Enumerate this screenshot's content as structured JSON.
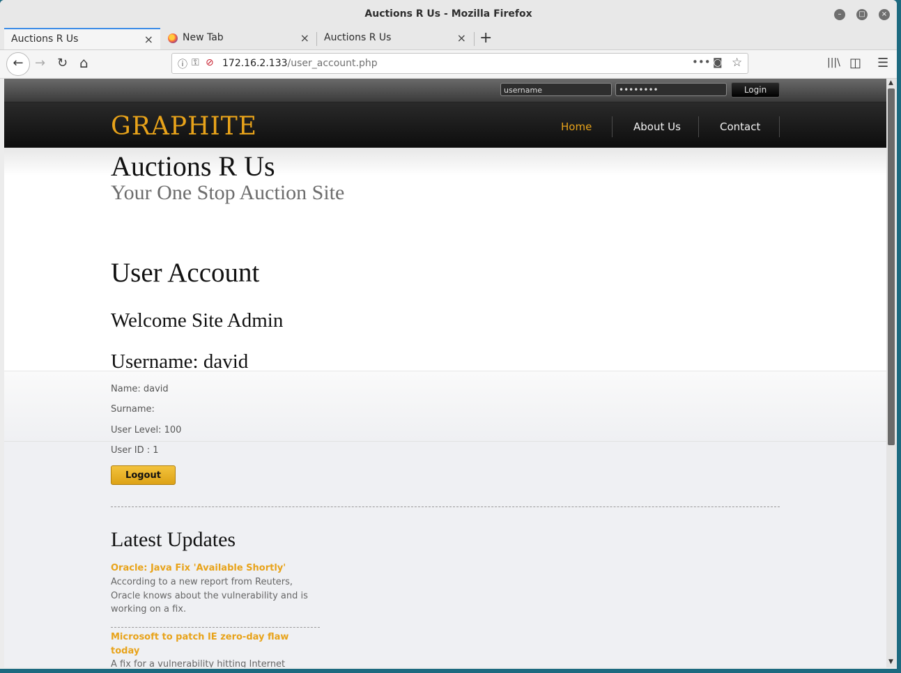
{
  "window": {
    "title": "Auctions R Us - Mozilla Firefox"
  },
  "tabs": [
    {
      "label": "Auctions R Us",
      "close": "×"
    },
    {
      "label": "New Tab",
      "close": "×"
    },
    {
      "label": "Auctions R Us",
      "close": "×"
    }
  ],
  "newtab": "+",
  "nav": {
    "url_host": "172.16.2.133",
    "url_path": "/user_account.php",
    "back": "←",
    "forward": "→",
    "reload": "↻",
    "home": "⌂",
    "more": "•••",
    "pocket": "◙",
    "bookmark": "☆",
    "library": "|||\\",
    "sidebar": "◫",
    "menu": "☰"
  },
  "login": {
    "username_placeholder": "username",
    "password_value": "••••••••",
    "button": "Login"
  },
  "site": {
    "logo": "GRAPHITE",
    "menu": [
      "Home",
      "About Us",
      "Contact"
    ],
    "title": "Auctions R Us",
    "subtitle": "Your One Stop Auction Site"
  },
  "account": {
    "heading": "User Account",
    "welcome": "Welcome Site Admin",
    "username": "Username: david",
    "name": "Name: david",
    "surname": "Surname:",
    "level": "User Level: 100",
    "userid": "User ID : 1",
    "logout": "Logout"
  },
  "updates": {
    "heading": "Latest Updates",
    "items": [
      {
        "title": "Oracle: Java Fix 'Available Shortly'",
        "body": "According to a new report from Reuters, Oracle knows about the vulnerability and is working on a fix."
      },
      {
        "title": "Microsoft to patch IE zero-day flaw today",
        "body": "A fix for a vulnerability hitting Internet"
      }
    ]
  },
  "colors": {
    "accent": "#e8a31a",
    "tab_highlight": "#3c8ce7"
  }
}
